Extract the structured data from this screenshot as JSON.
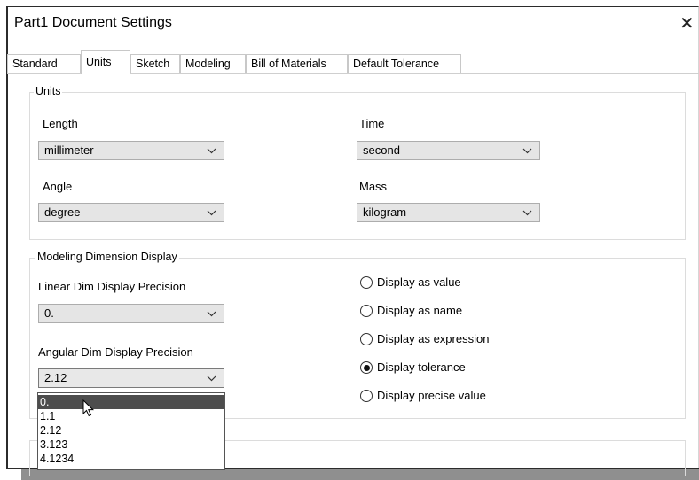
{
  "window": {
    "title": "Part1 Document Settings",
    "close_glyph": "✕"
  },
  "tabs": [
    {
      "label": "Standard",
      "active": false
    },
    {
      "label": "Units",
      "active": true
    },
    {
      "label": "Sketch",
      "active": false
    },
    {
      "label": "Modeling",
      "active": false
    },
    {
      "label": "Bill of Materials",
      "active": false
    },
    {
      "label": "Default Tolerance",
      "active": false
    }
  ],
  "units_group": {
    "legend": "Units",
    "length": {
      "label": "Length",
      "value": "millimeter"
    },
    "time": {
      "label": "Time",
      "value": "second"
    },
    "angle": {
      "label": "Angle",
      "value": "degree"
    },
    "mass": {
      "label": "Mass",
      "value": "kilogram"
    }
  },
  "display_group": {
    "legend": "Modeling Dimension Display",
    "linear": {
      "label": "Linear Dim Display Precision",
      "value": "0."
    },
    "angular": {
      "label": "Angular Dim Display Precision",
      "value": "2.12"
    },
    "radios": [
      {
        "label": "Display as value",
        "checked": false
      },
      {
        "label": "Display as name",
        "checked": false
      },
      {
        "label": "Display as expression",
        "checked": false
      },
      {
        "label": "Display tolerance",
        "checked": true
      },
      {
        "label": "Display precise value",
        "checked": false
      }
    ]
  },
  "angular_dropdown": {
    "options": [
      "0.",
      "1.1",
      "2.12",
      "3.123",
      "4.1234"
    ],
    "highlighted_index": 0
  },
  "icons": {
    "combo": "chevron-down-icon",
    "cursor": "mouse-pointer-icon"
  }
}
